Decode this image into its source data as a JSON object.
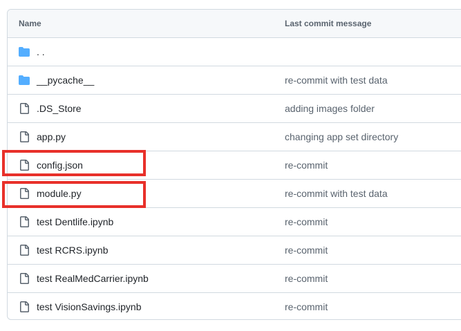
{
  "table": {
    "header_name": "Name",
    "header_message": "Last commit message"
  },
  "rows": [
    {
      "name": ". .",
      "message": "",
      "icon": "folder-icon",
      "type": "folder"
    },
    {
      "name": "__pycache__",
      "message": "re-commit with test data",
      "icon": "folder-icon",
      "type": "folder"
    },
    {
      "name": ".DS_Store",
      "message": "adding images folder",
      "icon": "file-icon",
      "type": "file"
    },
    {
      "name": "app.py",
      "message": "changing app set directory",
      "icon": "file-icon",
      "type": "file"
    },
    {
      "name": "config.json",
      "message": "re-commit",
      "icon": "file-icon",
      "type": "file",
      "highlighted": true
    },
    {
      "name": "module.py",
      "message": "re-commit with test data",
      "icon": "file-icon",
      "type": "file",
      "highlighted": true
    },
    {
      "name": "test Dentlife.ipynb",
      "message": "re-commit",
      "icon": "file-icon",
      "type": "file"
    },
    {
      "name": "test RCRS.ipynb",
      "message": "re-commit",
      "icon": "file-icon",
      "type": "file"
    },
    {
      "name": "test RealMedCarrier.ipynb",
      "message": "re-commit",
      "icon": "file-icon",
      "type": "file"
    },
    {
      "name": "test VisionSavings.ipynb",
      "message": "re-commit",
      "icon": "file-icon",
      "type": "file"
    }
  ],
  "colors": {
    "folder": "#54aeff",
    "highlight": "#e8302a"
  }
}
